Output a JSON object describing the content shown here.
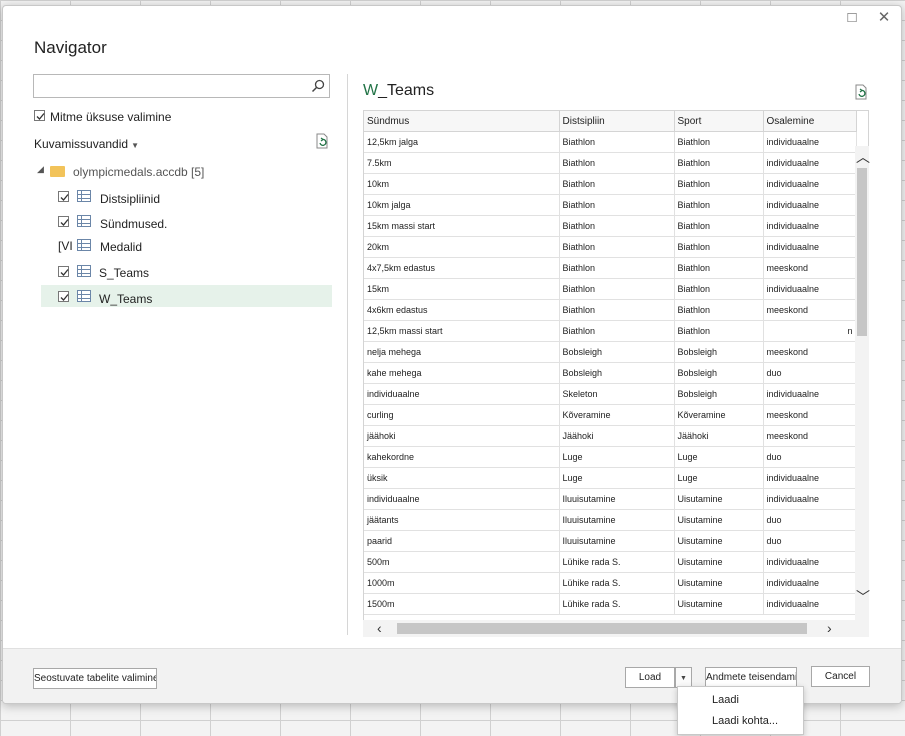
{
  "dialog": {
    "title": "Navigator"
  },
  "left": {
    "search_placeholder": "",
    "multi_select_label": "Mitme üksuse valimine",
    "display_options_label": "Kuvamissuvandid",
    "tree": {
      "root_label": "olympicmedals.accdb [5]",
      "items": [
        {
          "label": "Distsipliinid",
          "checked": true
        },
        {
          "label": "Sündmused.",
          "checked": true
        },
        {
          "label": "Medalid",
          "checked": false,
          "prefix": "[VI"
        },
        {
          "label": "S_Teams",
          "checked": true
        },
        {
          "label": "W_Teams",
          "checked": true,
          "selected": true
        }
      ]
    }
  },
  "preview": {
    "title_prefix": "W",
    "title_rest": "_Teams",
    "columns": [
      "Sündmus",
      "Distsipliin",
      "Sport",
      "Osalemine"
    ],
    "rows": [
      [
        "12,5km jalga",
        "Biathlon",
        "Biathlon",
        "individuaalne"
      ],
      [
        "7.5km",
        "Biathlon",
        "Biathlon",
        "individuaalne"
      ],
      [
        "10km",
        "Biathlon",
        "Biathlon",
        "individuaalne"
      ],
      [
        "10km jalga",
        "Biathlon",
        "Biathlon",
        "individuaalne"
      ],
      [
        "15km massi start",
        "Biathlon",
        "Biathlon",
        "individuaalne"
      ],
      [
        "20km",
        "Biathlon",
        "Biathlon",
        "individuaalne"
      ],
      [
        "4x7,5km edastus",
        "Biathlon",
        "Biathlon",
        "meeskond"
      ],
      [
        "15km",
        "Biathlon",
        "Biathlon",
        "individuaalne"
      ],
      [
        "4x6km edastus",
        "Biathlon",
        "Biathlon",
        "meeskond"
      ],
      [
        "12,5km massi start",
        "Biathlon",
        "Biathlon",
        "n"
      ],
      [
        "nelja mehega",
        "Bobsleigh",
        "Bobsleigh",
        "meeskond"
      ],
      [
        "kahe mehega",
        "Bobsleigh",
        "Bobsleigh",
        "duo"
      ],
      [
        "individuaalne",
        "Skeleton",
        "Bobsleigh",
        "individuaalne"
      ],
      [
        "curling",
        "Kõveramine",
        "Kõveramine",
        "meeskond"
      ],
      [
        "jäähoki",
        "Jäähoki",
        "Jäähoki",
        "meeskond"
      ],
      [
        "kahekordne",
        "Luge",
        "Luge",
        "duo"
      ],
      [
        "üksik",
        "Luge",
        "Luge",
        "individuaalne"
      ],
      [
        "individuaalne",
        "Iluuisutamine",
        "Uisutamine",
        "individuaalne"
      ],
      [
        "jäätants",
        "Iluuisutamine",
        "Uisutamine",
        "duo"
      ],
      [
        "paarid",
        "Iluuisutamine",
        "Uisutamine",
        "duo"
      ],
      [
        "500m",
        "Lühike rada S.",
        "Uisutamine",
        "individuaalne"
      ],
      [
        "1000m",
        "Lühike rada S.",
        "Uisutamine",
        "individuaalne"
      ],
      [
        "1500m",
        "Lühike rada S.",
        "Uisutamine",
        "individuaalne"
      ]
    ]
  },
  "footer": {
    "related_tables_label": "Seostuvate tabelite valimine",
    "load_label": "Load",
    "transform_label": "Andmete teisendamine",
    "cancel_label": "Cancel"
  },
  "load_menu": {
    "items": [
      "Laadi",
      "Laadi kohta..."
    ]
  },
  "colors": {
    "accent": "#217346",
    "selection": "#e6f2ea"
  }
}
